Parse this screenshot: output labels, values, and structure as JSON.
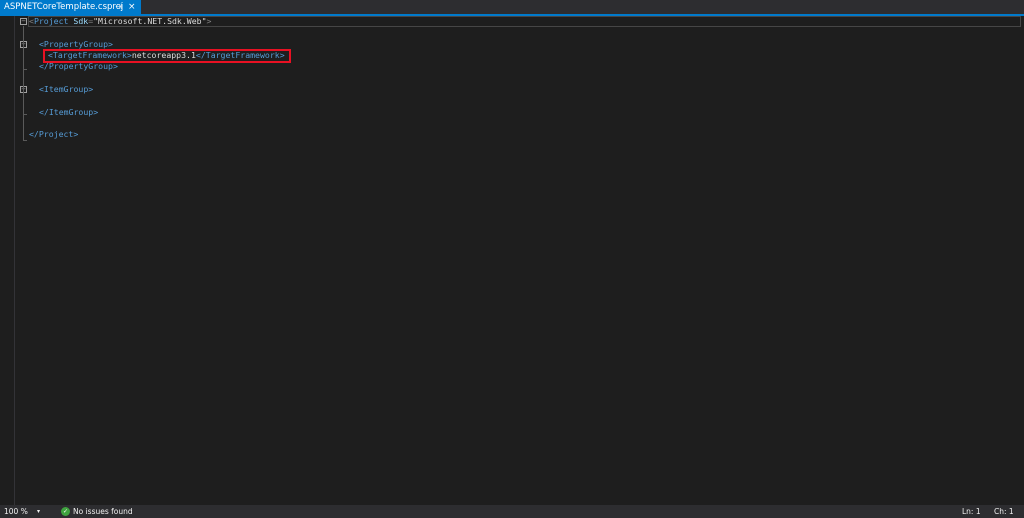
{
  "tab": {
    "title": "ASPNETCoreTemplate.csproj",
    "pin_icon": "pin-icon",
    "close_icon": "close-icon"
  },
  "code": {
    "line1": {
      "open": "<",
      "tag": "Project",
      "attr": "Sdk",
      "eq": "=",
      "value": "\"Microsoft.NET.Sdk.Web\"",
      "close": ">"
    },
    "line3": {
      "text": "<PropertyGroup>"
    },
    "line4": {
      "open_tag": "<TargetFramework>",
      "value": "netcoreapp3.1",
      "close_tag": "</TargetFramework>"
    },
    "line5": {
      "text": "</PropertyGroup>"
    },
    "line7": {
      "text": "<ItemGroup>"
    },
    "line9": {
      "text": "</ItemGroup>"
    },
    "line11": {
      "text": "</Project>"
    }
  },
  "status": {
    "zoom": "100 %",
    "zoom_arrow": "▾",
    "issues_icon": "check-circle-icon",
    "issues": "No issues found",
    "ln": "Ln: 1",
    "ch": "Ch: 1"
  },
  "colors": {
    "accent": "#007acc",
    "highlight": "#e81123",
    "tag": "#569cd6",
    "attr": "#9cdcfe",
    "string": "#ce9178"
  }
}
